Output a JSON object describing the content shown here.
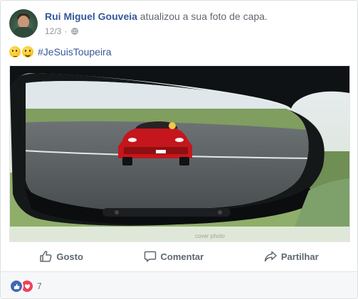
{
  "post": {
    "author": "Rui Miguel Gouveia",
    "action": "atualizou a sua foto de capa.",
    "date": "12/3",
    "separator": "·",
    "privacy_icon": "globe-icon",
    "caption_emojis": [
      "thinking-face-emoji",
      "smiling-face-emoji"
    ],
    "hashtag": "#JeSuisToupeira",
    "photo_watermark": "cover photo"
  },
  "actions": {
    "like_label": "Gosto",
    "comment_label": "Comentar",
    "share_label": "Partilhar"
  },
  "reactions": {
    "types": [
      "like",
      "love"
    ],
    "count": "7"
  },
  "colors": {
    "link": "#365899",
    "muted": "#90949c",
    "like": "#4267b2",
    "love": "#f33e58"
  }
}
